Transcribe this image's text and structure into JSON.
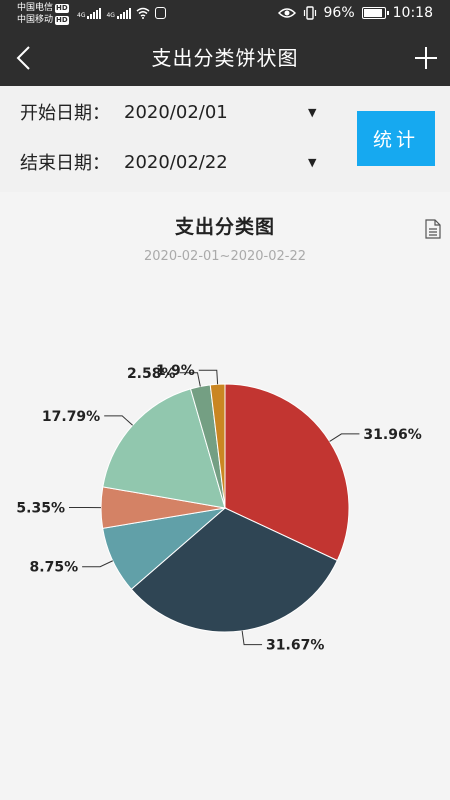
{
  "status_bar": {
    "carrier1": "中国电信",
    "carrier2": "中国移动",
    "hd": "HD",
    "net": "4G",
    "battery_pct": "96%",
    "battery_level": 0.96,
    "time": "10:18"
  },
  "app_bar": {
    "title": "支出分类饼状图"
  },
  "filters": {
    "start_label": "开始日期：",
    "start_value": "2020/02/01",
    "end_label": "结束日期：",
    "end_value": "2020/02/22",
    "caret": "▼",
    "submit_label": "统计"
  },
  "chart_data": {
    "type": "pie",
    "title": "支出分类图",
    "subtitle": "2020-02-01~2020-02-22",
    "slices": [
      {
        "label": "31.96%",
        "value": 31.96,
        "color": "#c23531"
      },
      {
        "label": "31.67%",
        "value": 31.67,
        "color": "#2f4554"
      },
      {
        "label": "8.75%",
        "value": 8.75,
        "color": "#61a0a8"
      },
      {
        "label": "5.35%",
        "value": 5.35,
        "color": "#d48265"
      },
      {
        "label": "17.79%",
        "value": 17.79,
        "color": "#91c7ae"
      },
      {
        "label": "2.58%",
        "value": 2.58,
        "color": "#749f83"
      },
      {
        "label": "1.9%",
        "value": 1.9,
        "color": "#ca8622"
      }
    ]
  }
}
